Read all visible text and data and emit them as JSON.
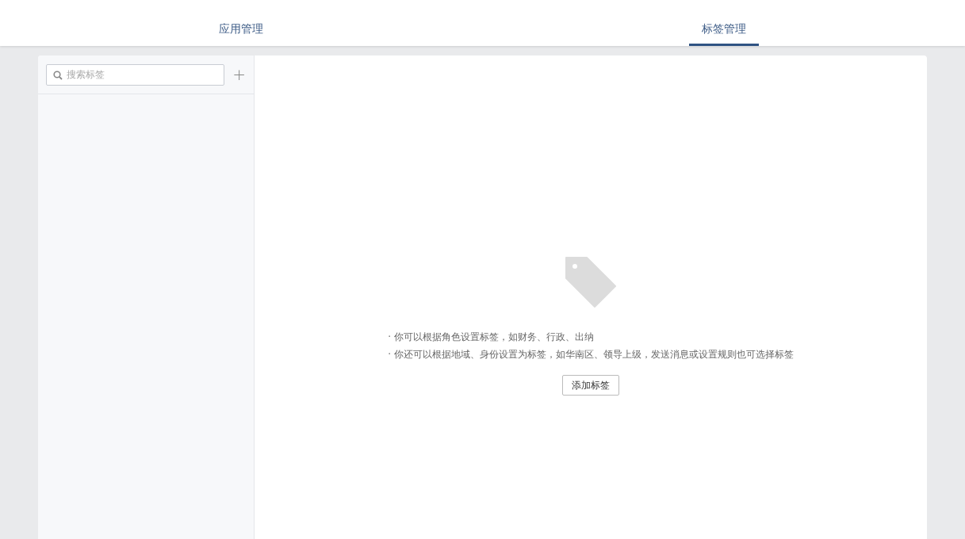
{
  "tabs": [
    {
      "label": "应用管理",
      "selected": false
    },
    {
      "label": "标签管理",
      "selected": true
    }
  ],
  "sidebar": {
    "search": {
      "placeholder": "搜索标签"
    },
    "add_button": "+"
  },
  "empty_state": {
    "hints": [
      "· 你可以根据角色设置标签，如财务、行政、出纳",
      "· 你还可以根据地域、身份设置为标签，如华南区、领导上级，发送消息或设置规则也可选择标签"
    ],
    "button": "添加标签"
  }
}
